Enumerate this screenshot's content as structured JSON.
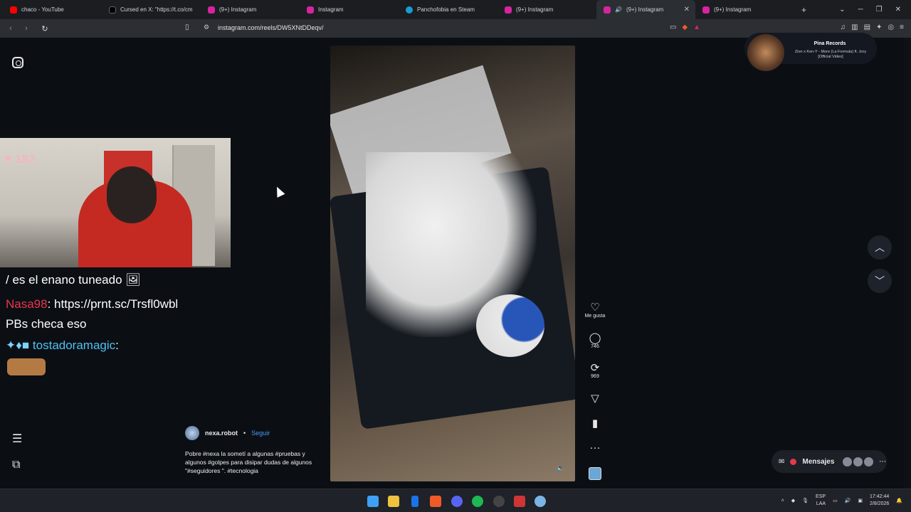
{
  "tabs": [
    {
      "label": "chaco - YouTube",
      "color": "#ff0000"
    },
    {
      "label": "Cursed en X: \"https://t.co/cm",
      "color": "#000000"
    },
    {
      "label": "(9+) Instagram",
      "color": "#d6249f"
    },
    {
      "label": "Instagram",
      "color": "#d6249f"
    },
    {
      "label": "Panchofobia en Steam",
      "color": "#1b9ad4"
    },
    {
      "label": "(9+) Instagram",
      "color": "#d6249f"
    },
    {
      "label": "(9+) Instagram",
      "color": "#d6249f",
      "active": true
    },
    {
      "label": "(9+) Instagram",
      "color": "#d6249f"
    }
  ],
  "address": {
    "url": "instagram.com/reels/DW5XNtDDeqv/"
  },
  "stream": {
    "likes": "182",
    "chat": [
      {
        "user": "",
        "text": "/ es el enano tuneado"
      },
      {
        "user": "Nasa98",
        "text": ": https://prnt.sc/Trsfl0wbl"
      },
      {
        "user": "",
        "text": "PBs checa eso"
      },
      {
        "user": "tostadoramagic",
        "text": ":"
      }
    ]
  },
  "reel": {
    "author": "nexa.robot",
    "separator": "•",
    "follow": "Seguir",
    "caption": "Pobre #nexa la sometí a algunas #pruebas y algunos #golpes para disipar dudas de algunos \"#seguidores \". #tecnologia",
    "likes_label": "Me gusta",
    "comments": "746",
    "reposts": "969"
  },
  "music": {
    "title": "Pina Records",
    "subtitle": "Zion x Ken-Y - More (La Formula) ft. Jory [Official Video]"
  },
  "messages": {
    "label": "Mensajes",
    "badge": "9+"
  },
  "tray": {
    "lang": "ESP",
    "region": "LAA",
    "time": "17:42:44",
    "date": "2/8/2026"
  },
  "icons": {
    "ig": "instagram-icon",
    "menu": "hamburger-icon",
    "more": "grid-icon"
  }
}
